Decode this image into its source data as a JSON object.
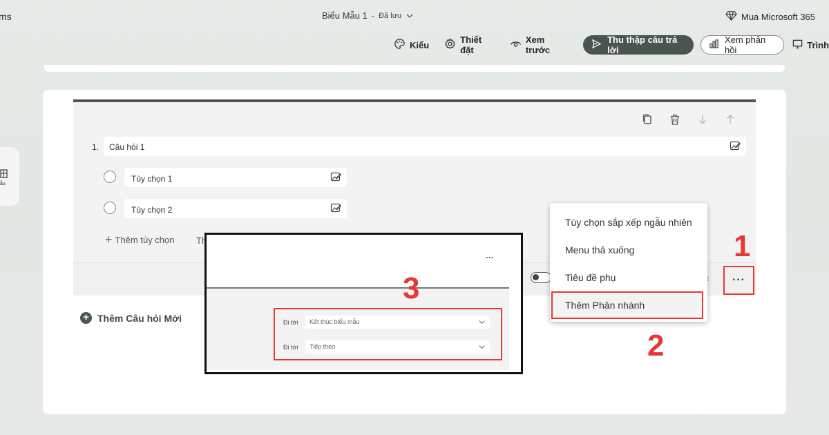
{
  "header": {
    "app_name": "ms",
    "form_title": "Biểu Mẫu 1",
    "separator": "-",
    "status": "Đã lưu",
    "buy_label": "Mua Microsoft 365"
  },
  "toolbar": {
    "style_label": "Kiểu",
    "settings_label": "Thiết đặt",
    "preview_label": "Xem trước",
    "collect_label": "Thu thập câu trả lời",
    "view_responses_label": "Xem phản hồi",
    "present_label": "Trình"
  },
  "left_rail": {
    "label": "ẫu"
  },
  "question": {
    "number": "1.",
    "title": "Câu hỏi 1",
    "options": [
      "Tùy chọn 1",
      "Tùy chọn 2"
    ],
    "add_option": "Thêm tùy chọn",
    "add_other_partial": "Th",
    "footer_partial": "c",
    "more_label": "···"
  },
  "menu": {
    "items": [
      "Tùy chọn sắp xếp ngẫu nhiên",
      "Menu thả xuống",
      "Tiêu đề phụ",
      "Thêm Phân nhánh"
    ],
    "highlighted_index": 3
  },
  "add_question": "Thêm Câu hỏi Mới",
  "annotations": {
    "step1": "1",
    "step2": "2",
    "step3": "3",
    "color": "#e53935"
  },
  "inset": {
    "dots": "···",
    "rows": [
      {
        "label": "Đi tới",
        "value": "Kết thúc biểu mẫu"
      },
      {
        "label": "Đi tới",
        "value": "Tiếp theo"
      }
    ]
  },
  "colors": {
    "accent_dark": "#4b5550",
    "annotation_red": "#e53935",
    "card_bg": "#ffffff"
  }
}
